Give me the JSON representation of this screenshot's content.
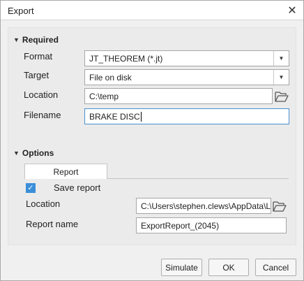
{
  "window": {
    "title": "Export"
  },
  "required": {
    "header": "Required",
    "format_label": "Format",
    "format_value": "JT_THEOREM (*.jt)",
    "target_label": "Target",
    "target_value": "File on disk",
    "location_label": "Location",
    "location_value": "C:\\temp",
    "filename_label": "Filename",
    "filename_value": "BRAKE DISC"
  },
  "options": {
    "header": "Options",
    "tab_report": "Report",
    "save_report_label": "Save report",
    "save_report_checked": true,
    "location_label": "Location",
    "location_value": "C:\\Users\\stephen.clews\\AppData\\L",
    "report_name_label": "Report name",
    "report_name_value": "ExportReport_(2045)"
  },
  "buttons": {
    "simulate": "Simulate",
    "ok": "OK",
    "cancel": "Cancel"
  }
}
